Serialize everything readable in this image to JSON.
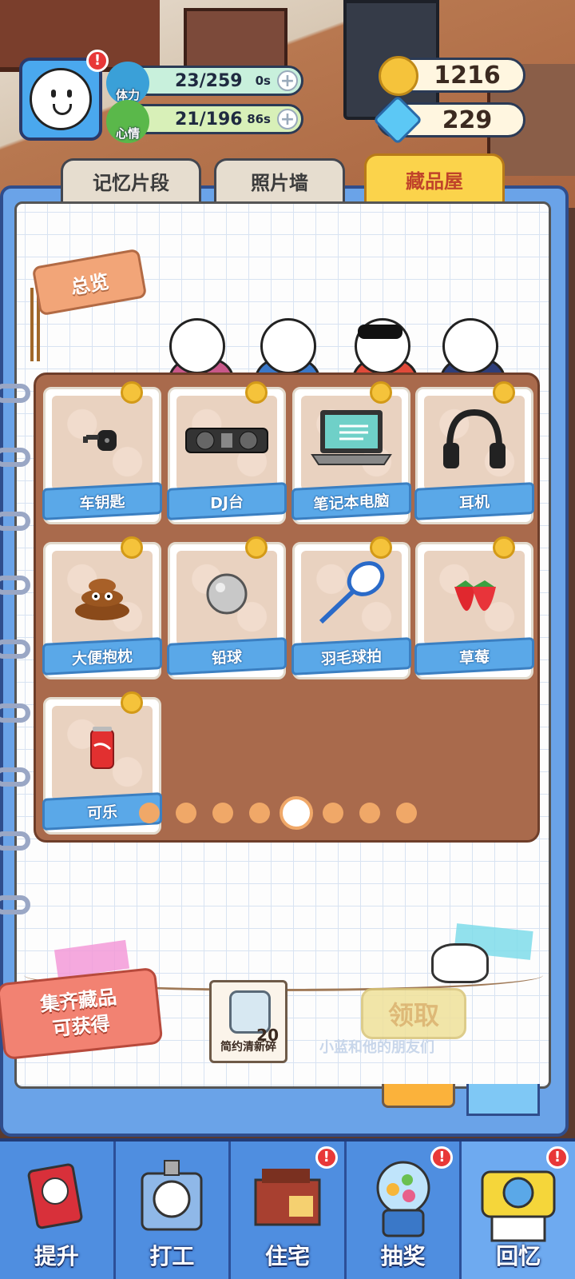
{
  "header": {
    "stamina": {
      "label": "体力",
      "value": "23/259",
      "timer": "0s"
    },
    "mood": {
      "label": "心情",
      "value": "21/196",
      "timer": "86s"
    },
    "coins": "1216",
    "gems": "229",
    "alert": "!"
  },
  "tabs": [
    {
      "label": "记忆片段",
      "active": false
    },
    {
      "label": "照片墙",
      "active": false
    },
    {
      "label": "藏品屋",
      "active": true
    }
  ],
  "overview_tag": "总览",
  "collection": {
    "items": [
      {
        "label": "车钥匙",
        "icon": "car-key-icon"
      },
      {
        "label": "DJ台",
        "icon": "dj-turntable-icon"
      },
      {
        "label": "笔记本电脑",
        "icon": "laptop-icon"
      },
      {
        "label": "耳机",
        "icon": "headphones-icon"
      },
      {
        "label": "大便抱枕",
        "icon": "poop-pillow-icon"
      },
      {
        "label": "铅球",
        "icon": "shot-put-icon"
      },
      {
        "label": "羽毛球拍",
        "icon": "badminton-racket-icon"
      },
      {
        "label": "草莓",
        "icon": "strawberry-icon"
      },
      {
        "label": "可乐",
        "icon": "cola-can-icon"
      }
    ],
    "page_count": 8,
    "current_page": 5
  },
  "reward": {
    "line1": "集齐藏品",
    "line2": "可获得",
    "item_name": "简约清新碎",
    "item_count": "20",
    "claim_label": "领取",
    "watermark": "小蓝和他的朋友们"
  },
  "nav": [
    {
      "label": "提升",
      "icon": "book-icon",
      "alert": false
    },
    {
      "label": "打工",
      "icon": "work-badge-icon",
      "alert": false
    },
    {
      "label": "住宅",
      "icon": "house-icon",
      "alert": true
    },
    {
      "label": "抽奖",
      "icon": "gacha-machine-icon",
      "alert": true
    },
    {
      "label": "回忆",
      "icon": "camera-icon",
      "alert": true
    }
  ],
  "colors": {
    "accent_blue": "#4f8ee0",
    "board_brown": "#a96a4c",
    "active_tab": "#fbd34b",
    "alert_red": "#e83838"
  }
}
